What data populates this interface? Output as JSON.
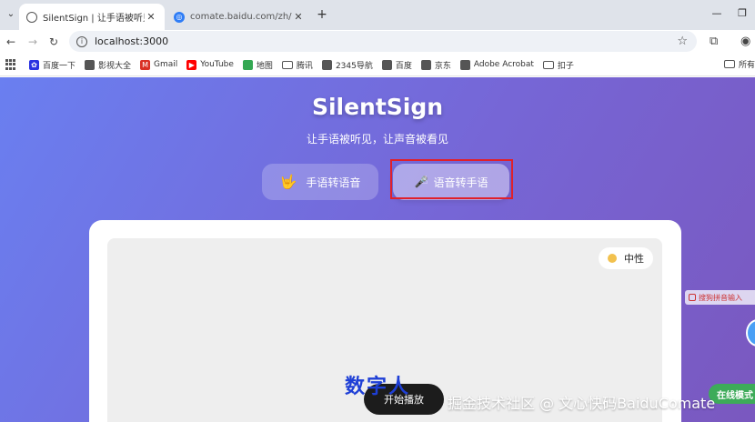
{
  "browser": {
    "tabs": [
      {
        "title": "SilentSign | 让手语被听见, 让",
        "active": true,
        "favicon": "globe-icon"
      },
      {
        "title": "comate.baidu.com/zh/activit",
        "active": false,
        "favicon": "comate-icon"
      }
    ],
    "url": "localhost:3000",
    "bookmarks": [
      {
        "label": "百度一下",
        "icon": "baidu-paw-icon",
        "color": "#2932e1"
      },
      {
        "label": "影视大全",
        "icon": "globe-icon",
        "color": "#555555"
      },
      {
        "label": "Gmail",
        "icon": "gmail-icon",
        "color": "#d93025"
      },
      {
        "label": "YouTube",
        "icon": "youtube-icon",
        "color": "#ff0000"
      },
      {
        "label": "地图",
        "icon": "map-icon",
        "color": "#34a853"
      },
      {
        "label": "腾讯",
        "icon": "folder-icon",
        "color": "#555555"
      },
      {
        "label": "2345导航",
        "icon": "globe-icon",
        "color": "#555555"
      },
      {
        "label": "百度",
        "icon": "globe-icon",
        "color": "#555555"
      },
      {
        "label": "京东",
        "icon": "globe-icon",
        "color": "#555555"
      },
      {
        "label": "Adobe Acrobat",
        "icon": "globe-icon",
        "color": "#555555"
      },
      {
        "label": "扣子",
        "icon": "folder-icon",
        "color": "#555555"
      }
    ],
    "bookmarks_right": "所有"
  },
  "app": {
    "title": "SilentSign",
    "subtitle": "让手语被听见，让声音被看见",
    "modes": [
      {
        "label": "手语转语音",
        "emoji": "🤟"
      },
      {
        "label": "语音转手语",
        "emoji": "🎤"
      }
    ],
    "emotion_label": "中性",
    "start_label": "开始播放",
    "overlay_text": "数字人"
  },
  "side": {
    "ime_label": "搜狗拼音输入",
    "online_label": "在线模式"
  },
  "watermark": "掘金技术社区 @ 文心快码BaiduComate",
  "colors": {
    "gradient_start": "#6a7ff0",
    "gradient_end": "#7a58bf",
    "highlight": "#e0202a",
    "online": "#3dab59",
    "overlay_text": "#1e3fd6"
  }
}
